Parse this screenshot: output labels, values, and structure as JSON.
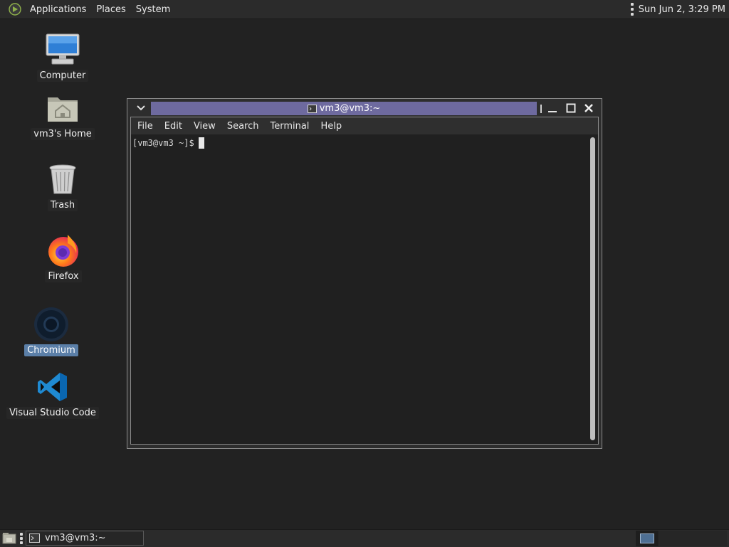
{
  "top_panel": {
    "menus": [
      "Applications",
      "Places",
      "System"
    ],
    "clock": "Sun Jun  2,  3:29 PM"
  },
  "desktop": {
    "icons": [
      {
        "label": "Computer",
        "icon": "computer-icon"
      },
      {
        "label": "vm3's Home",
        "icon": "home-folder-icon"
      },
      {
        "label": "Trash",
        "icon": "trash-icon"
      },
      {
        "label": "Firefox",
        "icon": "firefox-icon"
      },
      {
        "label": "Chromium",
        "icon": "chromium-icon",
        "selected": true
      },
      {
        "label": "Visual Studio Code",
        "icon": "vscode-icon"
      }
    ]
  },
  "terminal": {
    "title": "vm3@vm3:~",
    "menu": [
      "File",
      "Edit",
      "View",
      "Search",
      "Terminal",
      "Help"
    ],
    "prompt": "[vm3@vm3 ~]$"
  },
  "bottom_panel": {
    "task_label": "vm3@vm3:~"
  },
  "colors": {
    "desktop_bg": "#222222",
    "title_strip": "#6e6a9f",
    "selected_label": "#5b7fa8"
  }
}
